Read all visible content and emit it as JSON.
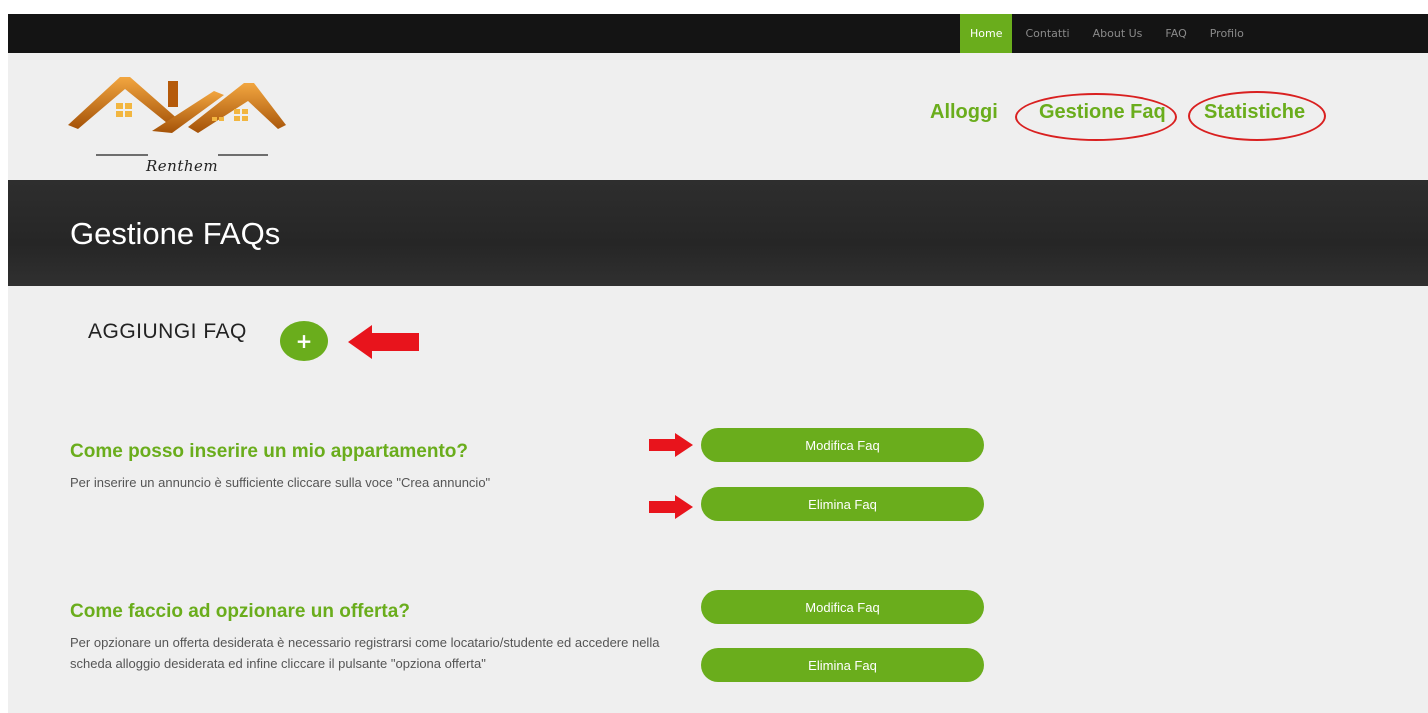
{
  "topnav": {
    "items": [
      {
        "label": "Home",
        "active": true
      },
      {
        "label": "Contatti",
        "active": false
      },
      {
        "label": "About Us",
        "active": false
      },
      {
        "label": "FAQ",
        "active": false
      },
      {
        "label": "Profilo",
        "active": false
      }
    ]
  },
  "logo": {
    "text": "Renthem"
  },
  "mainnav": {
    "alloggi": "Alloggi",
    "gestione_faq": "Gestione Faq",
    "statistiche": "Statistiche"
  },
  "banner": {
    "title": "Gestione FAQs"
  },
  "add_faq": {
    "label": "AGGIUNGI FAQ",
    "button": "+"
  },
  "faqs": [
    {
      "question": "Come posso inserire un mio appartamento?",
      "answer": "Per inserire un annuncio è sufficiente cliccare sulla voce \"Crea annuncio\"",
      "edit_label": "Modifica Faq",
      "delete_label": "Elimina Faq"
    },
    {
      "question": "Come faccio ad opzionare un offerta?",
      "answer": "Per opzionare un offerta desiderata è necessario registrarsi come locatario/studente ed accedere nella scheda alloggio desiderata ed infine cliccare il pulsante \"opziona offerta\"",
      "edit_label": "Modifica Faq",
      "delete_label": "Elimina Faq"
    }
  ],
  "colors": {
    "accent": "#6aad1c",
    "topbar": "#141414",
    "banner": "#2b2b2b",
    "annotation_red": "#d92020"
  }
}
